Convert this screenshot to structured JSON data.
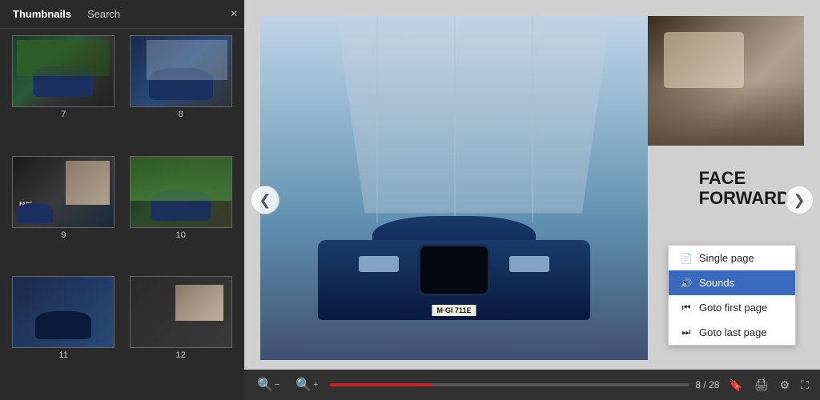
{
  "sidebar": {
    "tabs": [
      {
        "id": "thumbnails",
        "label": "Thumbnails",
        "active": true
      },
      {
        "id": "search",
        "label": "Search",
        "active": false
      }
    ],
    "close_icon": "×",
    "thumbnails": [
      {
        "page": 7,
        "label": "7"
      },
      {
        "page": 8,
        "label": "8"
      },
      {
        "page": 9,
        "label": "9"
      },
      {
        "page": 10,
        "label": "10"
      },
      {
        "page": 11,
        "label": "11"
      },
      {
        "page": 12,
        "label": "12"
      }
    ]
  },
  "viewer": {
    "nav_prev": "❮",
    "nav_next": "❯",
    "current_page": 8,
    "total_pages": 28,
    "page_indicator": "8 / 28",
    "progress_percent": 28.57,
    "face_forward_line1": "FACE",
    "face_forward_line2": "FORWARD.",
    "plate_text": "M·GI 711E"
  },
  "toolbar": {
    "zoom_in_icon": "+",
    "zoom_out_icon": "−",
    "bookmark_icon": "🔖",
    "print_icon": "🖨",
    "settings_icon": "⚙",
    "fullscreen_icon": "⛶"
  },
  "context_menu": {
    "items": [
      {
        "id": "single-page",
        "label": "Single page",
        "icon": "📄",
        "selected": false
      },
      {
        "id": "sounds",
        "label": "Sounds",
        "icon": "🔊",
        "selected": true
      },
      {
        "id": "goto-first",
        "label": "Goto first page",
        "icon": "⏮",
        "selected": false
      },
      {
        "id": "goto-last",
        "label": "Goto last page",
        "icon": "⏭",
        "selected": false
      }
    ]
  },
  "colors": {
    "accent_red": "#cc2222",
    "sidebar_bg": "#2a2a2a",
    "menu_selected": "#3a6abf"
  }
}
